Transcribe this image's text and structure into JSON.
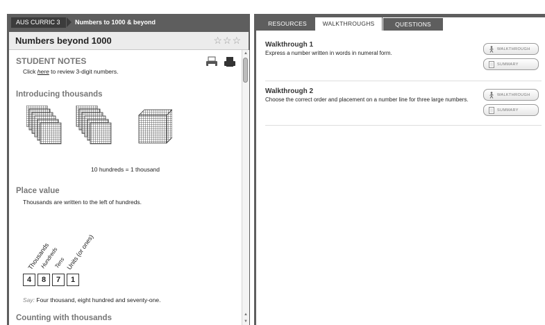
{
  "left": {
    "breadcrumb": {
      "course": "AUS CURRIC 3",
      "topic": "Numbers to 1000 & beyond"
    },
    "title": "Numbers beyond 1000",
    "rating_stars": "☆☆☆",
    "student_notes": {
      "heading": "STUDENT NOTES",
      "review_prefix": "Click ",
      "review_link": "here",
      "review_suffix": " to review 3-digit numbers.",
      "icons": [
        "printer-icon",
        "print-full-icon"
      ]
    },
    "intro": {
      "heading": "Introducing thousands",
      "caption": "10 hundreds = 1 thousand"
    },
    "place_value": {
      "heading": "Place value",
      "desc": "Thousands are written to the left of hundreds.",
      "columns": [
        "Thousands",
        "Hundreds",
        "Tens",
        "Units (or ones)"
      ],
      "digits": [
        "4",
        "8",
        "7",
        "1"
      ],
      "say_label": "Say:",
      "say_text": " Four thousand, eight hundred and seventy-one."
    },
    "counting": {
      "heading": "Counting with thousands"
    }
  },
  "right": {
    "tabs": [
      {
        "label": "RESOURCES"
      },
      {
        "label": "WALKTHROUGHS",
        "active": true
      },
      {
        "label": "QUESTIONS"
      }
    ],
    "walkthroughs": [
      {
        "title": "Walkthrough 1",
        "desc": "Express a number written in words in numeral form.",
        "walkthrough_label": "WALKTHROUGH",
        "summary_label": "SUMMARY"
      },
      {
        "title": "Walkthrough 2",
        "desc": "Choose the correct order and placement on a number line for three large numbers.",
        "walkthrough_label": "WALKTHROUGH",
        "summary_label": "SUMMARY"
      }
    ]
  },
  "colors": {
    "frame": "#5e5e5e",
    "heading_grey": "#777777",
    "breadcrumb_dark": "#3c3c3c"
  }
}
